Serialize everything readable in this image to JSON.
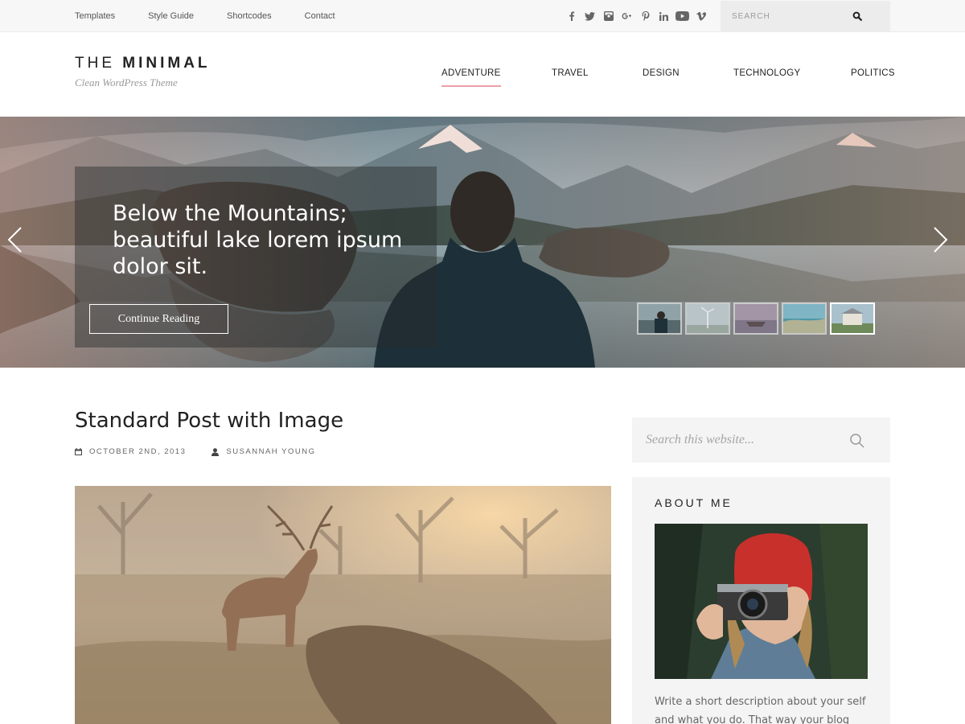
{
  "topbar": {
    "links": [
      "Templates",
      "Style Guide",
      "Shortcodes",
      "Contact"
    ],
    "social_icons": [
      "facebook-icon",
      "twitter-icon",
      "instagram-icon",
      "google-plus-icon",
      "pinterest-icon",
      "linkedin-icon",
      "youtube-icon",
      "vimeo-icon"
    ],
    "search_placeholder": "SEARCH"
  },
  "header": {
    "logo_light": "THE",
    "logo_bold": "MINIMAL",
    "tagline": "Clean WordPress Theme",
    "nav": [
      "ADVENTURE",
      "TRAVEL",
      "DESIGN",
      "TECHNOLOGY",
      "POLITICS"
    ],
    "active_nav": "ADVENTURE",
    "accent_color": "#e8a0a8"
  },
  "hero": {
    "title": "Below the Mountains; beautiful lake lorem ipsum dolor sit.",
    "button_label": "Continue Reading"
  },
  "post": {
    "title": "Standard Post with Image",
    "date": "OCTOBER 2ND, 2013",
    "author": "SUSANNAH YOUNG"
  },
  "sidebar": {
    "search_placeholder": "Search this website...",
    "about_title": "ABOUT ME",
    "about_text": "Write a short description about your self and what you do. That way your blog"
  }
}
